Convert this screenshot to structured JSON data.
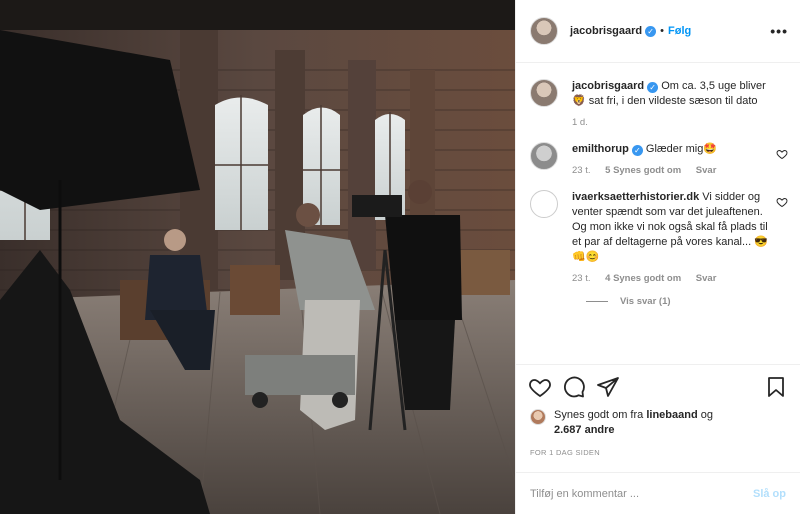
{
  "header": {
    "username": "jacobrisgaard",
    "separator": "•",
    "follow_label": "Følg",
    "more_icon": "more-horizontal-icon"
  },
  "caption": {
    "username": "jacobrisgaard",
    "text_part1": "Om ca. 3,5 uge bliver",
    "emoji": "🦁",
    "text_part2": "sat fri, i den vildeste sæson til dato",
    "time": "1 d."
  },
  "comments": [
    {
      "username": "emilthorup",
      "text": "Glæder mig🤩",
      "time": "23 t.",
      "likes": "5 Synes godt om",
      "reply": "Svar"
    },
    {
      "username": "ivaerksaetterhistorier.dk",
      "text": "Vi sidder og venter spændt som var det juleaftenen. Og mon ikke vi nok også skal få plads til et par af deltagerne på vores kanal... 😎👊😊",
      "time": "23 t.",
      "likes": "4 Synes godt om",
      "reply": "Svar",
      "view_replies": "Vis svar (1)"
    }
  ],
  "actions": {
    "like_icon": "heart-icon",
    "comment_icon": "comment-icon",
    "share_icon": "share-icon",
    "save_icon": "bookmark-icon"
  },
  "likes": {
    "prefix": "Synes godt om fra",
    "user": "linebaand",
    "joiner": "og",
    "count": "2.687 andre"
  },
  "date": "FOR 1 DAG SIDEN",
  "add_comment": {
    "placeholder": "Tilføj en kommentar ...",
    "post_label": "Slå op"
  },
  "colors": {
    "accent": "#0095f6",
    "verified": "#3897f0",
    "muted": "#8e8e8e",
    "post_disabled": "#b2dffc"
  }
}
